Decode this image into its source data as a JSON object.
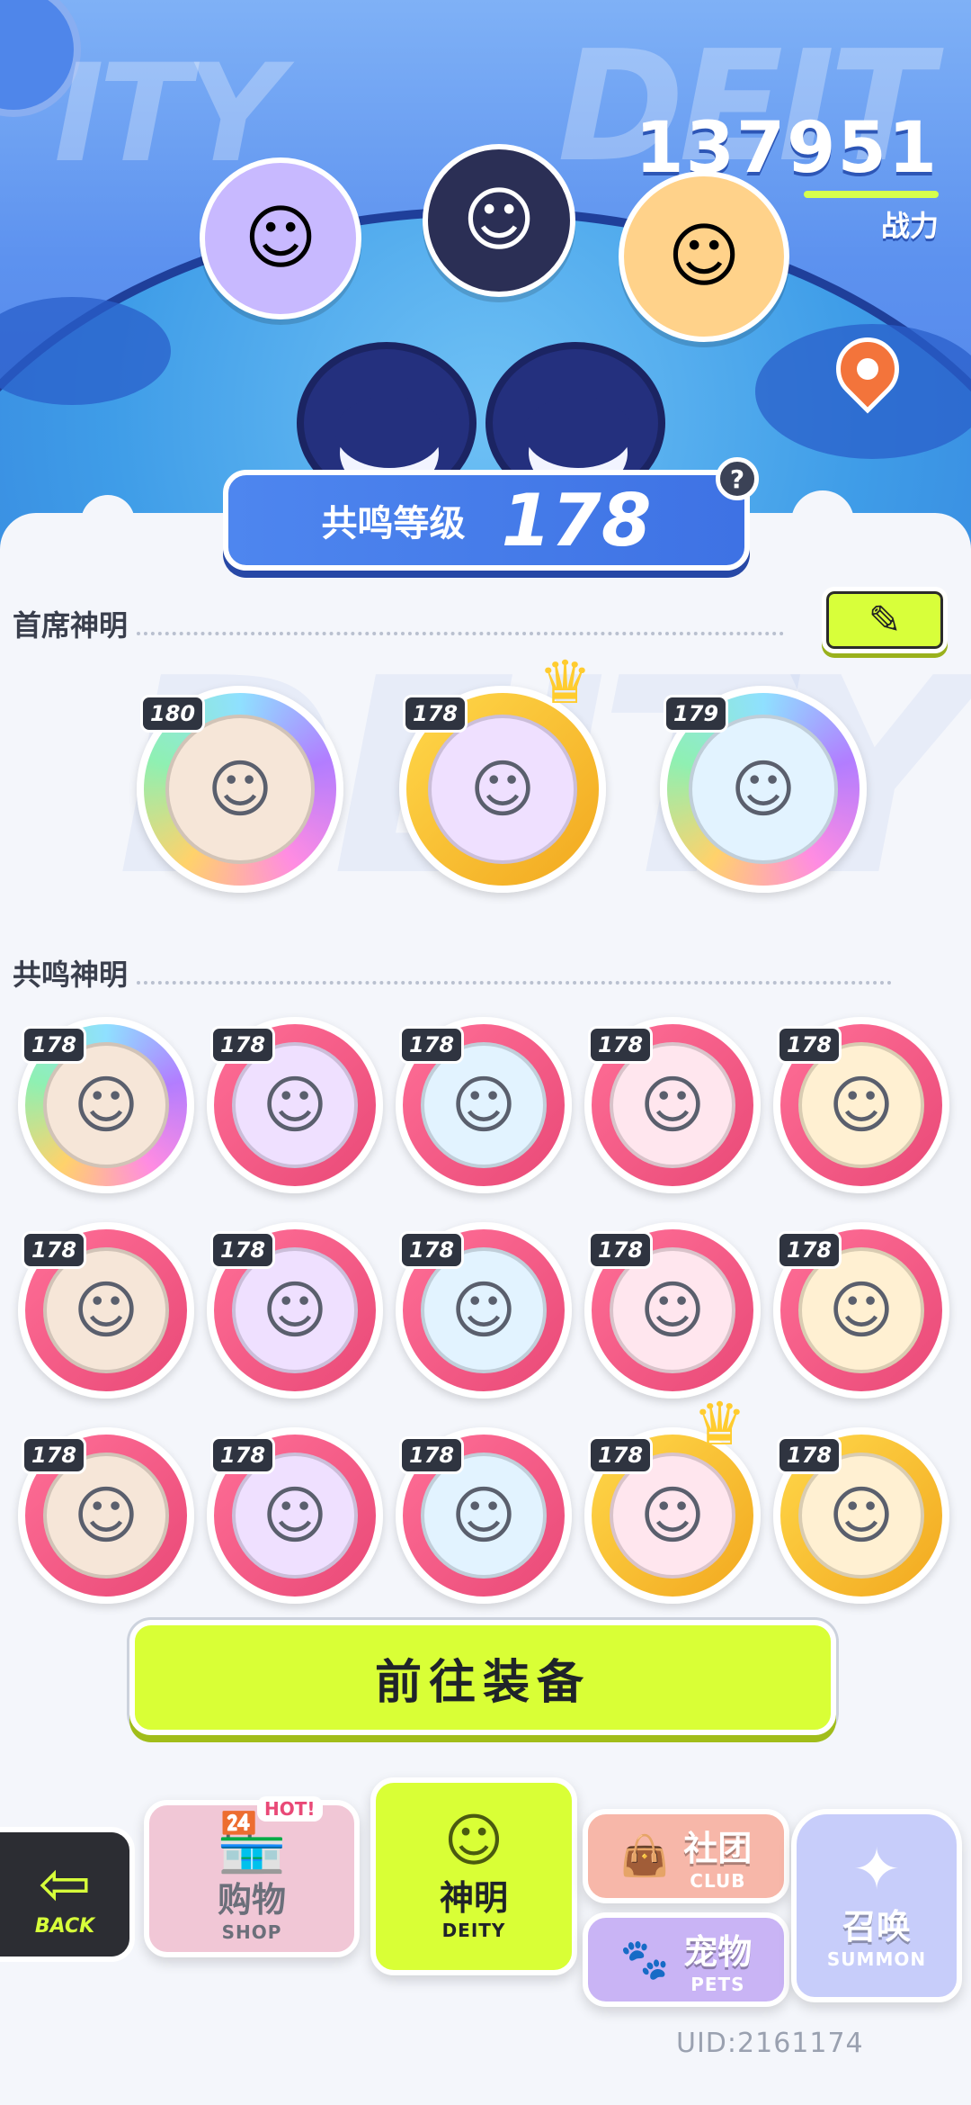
{
  "header": {
    "bg_word_left": "ITY",
    "bg_word_right": "DEIT",
    "power_value": "137951",
    "power_label": "战力"
  },
  "resonance": {
    "label": "共鸣等级",
    "value": "178",
    "help": "?"
  },
  "sections": {
    "chief_title": "首席神明",
    "resonance_title": "共鸣神明",
    "watermark": "DEITY"
  },
  "edit_icon": "pencil-icon",
  "chief_deities": [
    {
      "level": "180",
      "frame": "rainbow"
    },
    {
      "level": "178",
      "frame": "gold",
      "crown": true
    },
    {
      "level": "179",
      "frame": "rainbow"
    }
  ],
  "resonance_deities": [
    {
      "level": "178",
      "frame": "rainbow"
    },
    {
      "level": "178",
      "frame": "pink"
    },
    {
      "level": "178",
      "frame": "pink"
    },
    {
      "level": "178",
      "frame": "pink"
    },
    {
      "level": "178",
      "frame": "pink"
    },
    {
      "level": "178",
      "frame": "pink"
    },
    {
      "level": "178",
      "frame": "pink"
    },
    {
      "level": "178",
      "frame": "pink"
    },
    {
      "level": "178",
      "frame": "pink"
    },
    {
      "level": "178",
      "frame": "pink"
    },
    {
      "level": "178",
      "frame": "pink"
    },
    {
      "level": "178",
      "frame": "pink"
    },
    {
      "level": "178",
      "frame": "pink"
    },
    {
      "level": "178",
      "frame": "gold",
      "crown": true
    },
    {
      "level": "178",
      "frame": "gold"
    }
  ],
  "equip_button": "前往装备",
  "nav": {
    "back_en": "BACK",
    "shop_hot": "HOT!",
    "shop_cn": "购物",
    "shop_en": "SHOP",
    "deity_cn": "神明",
    "deity_en": "DEITY",
    "club_cn": "社团",
    "club_en": "CLUB",
    "pets_cn": "宠物",
    "pets_en": "PETS",
    "summon_cn": "召唤",
    "summon_en": "SUMMON"
  },
  "uid": "UID:2161174",
  "colors": {
    "accent": "#d9ff36",
    "header_blue": "#5d92ef",
    "frame_pink": "#e94977",
    "frame_gold": "#f2a81f"
  }
}
